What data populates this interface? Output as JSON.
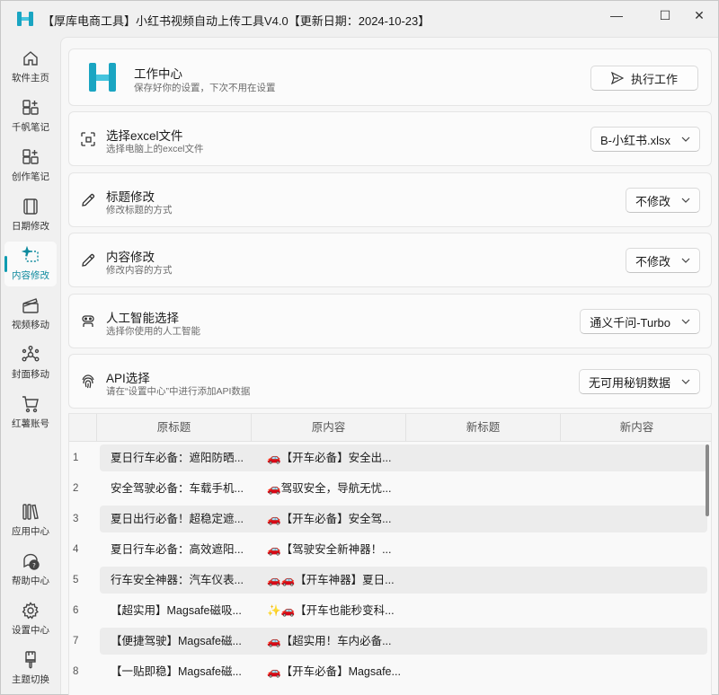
{
  "titlebar": {
    "title": "【厚库电商工具】小红书视频自动上传工具V4.0【更新日期：2024-10-23】",
    "minimize": "—",
    "maximize": "☐",
    "close": "✕"
  },
  "sidebar": {
    "items": [
      {
        "label": "软件主页",
        "icon": "home-icon"
      },
      {
        "label": "千帆笔记",
        "icon": "grid-plus-icon"
      },
      {
        "label": "创作笔记",
        "icon": "grid-plus-icon"
      },
      {
        "label": "日期修改",
        "icon": "calendar-film-icon"
      },
      {
        "label": "内容修改",
        "icon": "sparkle-select-icon"
      },
      {
        "label": "视频移动",
        "icon": "clapper-icon"
      },
      {
        "label": "封面移动",
        "icon": "nodes-icon"
      },
      {
        "label": "红薯账号",
        "icon": "cart-icon"
      },
      {
        "label": "应用中心",
        "icon": "library-icon"
      },
      {
        "label": "帮助中心",
        "icon": "help-chat-icon"
      },
      {
        "label": "设置中心",
        "icon": "gear-icon"
      },
      {
        "label": "主题切换",
        "icon": "brush-icon"
      }
    ],
    "active_index": 4,
    "accent": "#0e9bb0"
  },
  "header_card": {
    "title": "工作中心",
    "subtitle": "保存好你的设置，下次不用在设置",
    "run_button": "执行工作"
  },
  "settings": [
    {
      "title": "选择excel文件",
      "subtitle": "选择电脑上的excel文件",
      "value": "B-小红书.xlsx",
      "icon": "file-select-icon"
    },
    {
      "title": "标题修改",
      "subtitle": "修改标题的方式",
      "value": "不修改",
      "icon": "pencil-icon"
    },
    {
      "title": "内容修改",
      "subtitle": "修改内容的方式",
      "value": "不修改",
      "icon": "pencil-icon"
    },
    {
      "title": "人工智能选择",
      "subtitle": "选择你使用的人工智能",
      "value": "通义千问-Turbo",
      "icon": "robot-icon"
    },
    {
      "title": "API选择",
      "subtitle": "请在“设置中心”中进行添加API数据",
      "value": "无可用秘钥数据",
      "icon": "fingerprint-icon"
    }
  ],
  "table": {
    "columns": [
      "原标题",
      "原内容",
      "新标题",
      "新内容"
    ],
    "rows": [
      {
        "num": "1",
        "title": "夏日行车必备：遮阳防晒...",
        "content": "🚗【开车必备】安全出...",
        "new_title": "",
        "new_content": ""
      },
      {
        "num": "2",
        "title": "安全驾驶必备：车载手机...",
        "content": "🚗驾驭安全，导航无忧...",
        "new_title": "",
        "new_content": ""
      },
      {
        "num": "3",
        "title": "夏日出行必备！超稳定遮...",
        "content": "🚗【开车必备】安全驾...",
        "new_title": "",
        "new_content": ""
      },
      {
        "num": "4",
        "title": "夏日行车必备：高效遮阳...",
        "content": "🚗【驾驶安全新神器！...",
        "new_title": "",
        "new_content": ""
      },
      {
        "num": "5",
        "title": "行车安全神器：汽车仪表...",
        "content": "🚗🚗【开车神器】夏日...",
        "new_title": "",
        "new_content": ""
      },
      {
        "num": "6",
        "title": "【超实用】Magsafe磁吸...",
        "content": "✨🚗【开车也能秒变科...",
        "new_title": "",
        "new_content": ""
      },
      {
        "num": "7",
        "title": "【便捷驾驶】Magsafe磁...",
        "content": "🚗【超实用！车内必备...",
        "new_title": "",
        "new_content": ""
      },
      {
        "num": "8",
        "title": "【一贴即稳】Magsafe磁...",
        "content": "🚗【开车必备】Magsafe...",
        "new_title": "",
        "new_content": ""
      }
    ]
  }
}
